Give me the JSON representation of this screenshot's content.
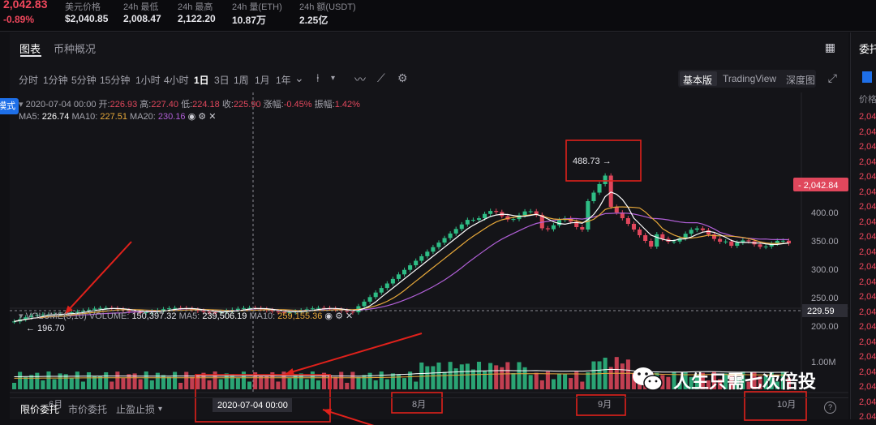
{
  "header": {
    "last_price": "2,042.83",
    "change": "-0.89%",
    "stats": [
      {
        "label": "美元价格",
        "value": "$2,040.85"
      },
      {
        "label": "24h 最低",
        "value": "2,008.47"
      },
      {
        "label": "24h 最高",
        "value": "2,122.20"
      },
      {
        "label": "24h 量(ETH)",
        "value": "10.87万"
      },
      {
        "label": "24h 额(USDT)",
        "value": "2.25亿"
      }
    ]
  },
  "tabs": [
    "图表",
    "币种概况"
  ],
  "timeframes": [
    "分时",
    "1分钟",
    "5分钟",
    "15分钟",
    "1小时",
    "4小时",
    "1日",
    "3日",
    "1周",
    "1月",
    "1年"
  ],
  "active_timeframe": "1日",
  "view_modes": [
    "基本版",
    "TradingView",
    "深度图"
  ],
  "mode_button": "模式",
  "ohlc": {
    "date": "2020-07-04 00:00",
    "open_label": "开:",
    "open": "226.93",
    "high_label": "高:",
    "high": "227.40",
    "low_label": "低:",
    "low": "224.18",
    "close_label": "收:",
    "close": "225.90",
    "change_label": "涨幅:",
    "change": "-0.45%",
    "amplitude_label": "振幅:",
    "amplitude": "1.42%"
  },
  "ma": {
    "ma5_label": "MA5:",
    "ma5": "226.74",
    "ma10_label": "MA10:",
    "ma10": "227.51",
    "ma20_label": "MA20:",
    "ma20": "230.16"
  },
  "volume": {
    "label": "VOLUME(5,10)",
    "vol_label": "VOLUME:",
    "vol": "150,397.32",
    "ma5_label": "MA5:",
    "ma5": "239,506.19",
    "ma10_label": "MA10:",
    "ma10": "259,155.36",
    "axis_tick": "1.00M"
  },
  "price_axis": [
    "400.00",
    "350.00",
    "300.00",
    "250.00",
    "200.00"
  ],
  "current_price_tag": "2,042.84",
  "crosshair_price_tag": "229.59",
  "high_marker": "488.73",
  "low_marker": "196.70",
  "months": [
    "6月",
    "8月",
    "9月",
    "10月"
  ],
  "crosshair_date": "2020-07-04 00:00",
  "bottom_tabs": [
    "限价委托",
    "市价委托",
    "止盈止损"
  ],
  "side_panel": {
    "title": "委托",
    "col": "价格",
    "rows": [
      "2,04",
      "2,04",
      "2,04",
      "2,04",
      "2,04",
      "2,04",
      "2,04",
      "2,04",
      "2,04",
      "2,04",
      "2,04",
      "2,04",
      "2,04",
      "2,04",
      "2,04",
      "2,04",
      "2,04",
      "2,04",
      "2,04",
      "2,04",
      "2,04"
    ]
  },
  "watermark": "人生只需七次倍投",
  "colors": {
    "up": "#2ebd85",
    "down": "#e0475c",
    "ma5": "#ffffff",
    "ma10": "#e8a93a",
    "ma20": "#b05fd6",
    "annotation": "#e0211b"
  }
}
